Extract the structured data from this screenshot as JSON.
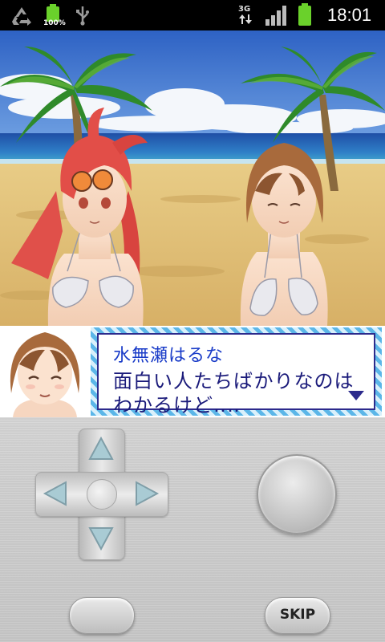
{
  "status_bar": {
    "battery_percent_label": "100%",
    "network_label": "3G",
    "time": "18:01"
  },
  "dialog": {
    "speaker": "水無瀬はるな",
    "lines": [
      "面白い人たちばかりなのは",
      "わかるけど‥‥"
    ]
  },
  "controls": {
    "skip_label": "SKIP"
  },
  "icons": {
    "recycle": "recycle-icon",
    "battery_small": "battery-icon",
    "usb": "usb-icon",
    "signal": "signal-icon",
    "battery_large": "battery-charging-icon",
    "dpad_up": "arrow-up-icon",
    "dpad_down": "arrow-down-icon",
    "dpad_left": "arrow-left-icon",
    "dpad_right": "arrow-right-icon",
    "more": "triangle-down-icon"
  },
  "colors": {
    "speaker_text": "#1a3cc8",
    "message_text": "#1a1a7a",
    "frame_stripe": "#5bb6e8",
    "battery_green": "#6ad12b"
  }
}
